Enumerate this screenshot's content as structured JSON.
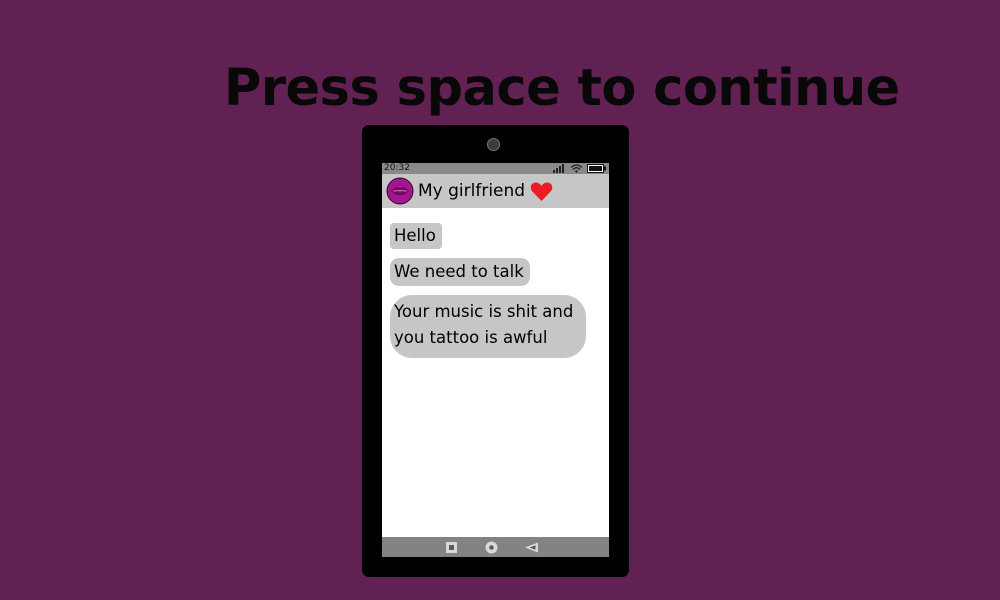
{
  "prompt": "Press space to continue",
  "status_bar": {
    "time": "20:32",
    "icons": [
      "signal-icon",
      "wifi-icon",
      "battery-icon"
    ]
  },
  "chat": {
    "contact_name": "My girlfriend",
    "avatar_icon": "lips-avatar-icon",
    "status_icon": "heart-icon",
    "messages": [
      "Hello",
      "We need to talk",
      "Your music is shit and you tattoo is awful"
    ]
  },
  "navbar": {
    "buttons": [
      "recents-button",
      "home-button",
      "back-button"
    ]
  },
  "colors": {
    "background": "#612152",
    "prompt_text": "#080808",
    "phone_body": "#000000",
    "screen": "#ffffff",
    "header": "#c6c6c6",
    "bubble": "#c6c6c6",
    "status_bar": "#8a8a8a",
    "nav_bar": "#838383",
    "heart": "#ed1c24",
    "avatar": "#a3168f"
  }
}
